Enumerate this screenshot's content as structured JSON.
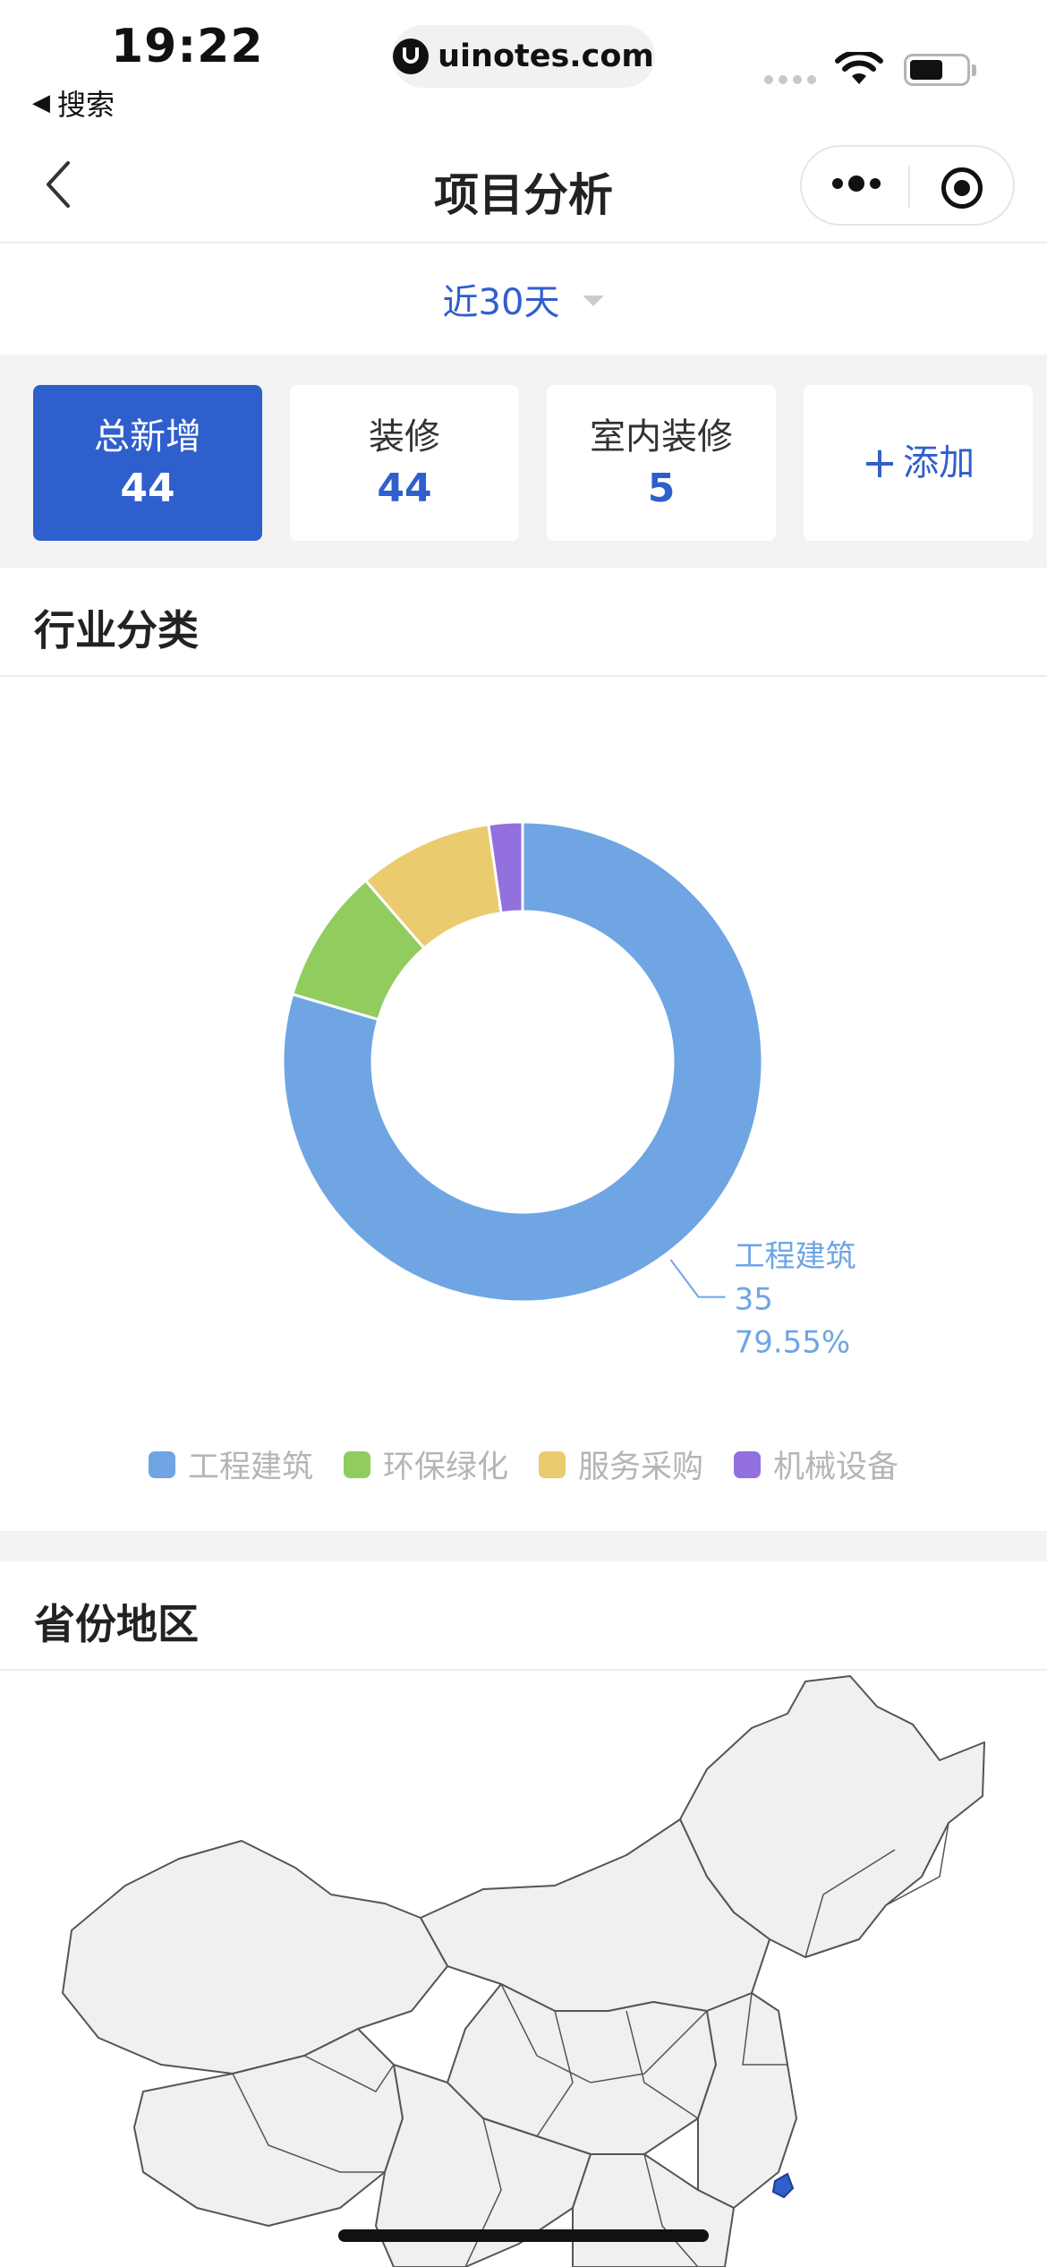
{
  "status_bar": {
    "time": "19:22",
    "back_app": "搜索",
    "url": "uinotes.com",
    "battery_level": 0.6
  },
  "nav": {
    "title": "项目分析",
    "back_icon": "chevron-left-icon",
    "more_icon": "more-dots-icon",
    "close_icon": "target-circle-icon"
  },
  "range_selector": {
    "label": "近30天",
    "caret_icon": "caret-down-icon"
  },
  "stats": {
    "cards": [
      {
        "label": "总新增",
        "value": "44",
        "active": true
      },
      {
        "label": "装修",
        "value": "44",
        "active": false
      },
      {
        "label": "室内装修",
        "value": "5",
        "active": false
      }
    ],
    "add_plus": "+",
    "add_label": "添加"
  },
  "sections": {
    "industry_title": "行业分类",
    "region_title": "省份地区"
  },
  "colors": {
    "accent": "#2f5fcc",
    "series": [
      "#6fa5e3",
      "#91cc5f",
      "#eacb6e",
      "#9270de"
    ]
  },
  "chart_data": {
    "type": "pie",
    "donut": true,
    "categories": [
      "工程建筑",
      "环保绿化",
      "服务采购",
      "机械设备"
    ],
    "values": [
      35,
      4,
      4,
      1
    ],
    "callout": {
      "category": "工程建筑",
      "value": "35",
      "percent": "79.55%"
    },
    "legend_position": "bottom"
  }
}
